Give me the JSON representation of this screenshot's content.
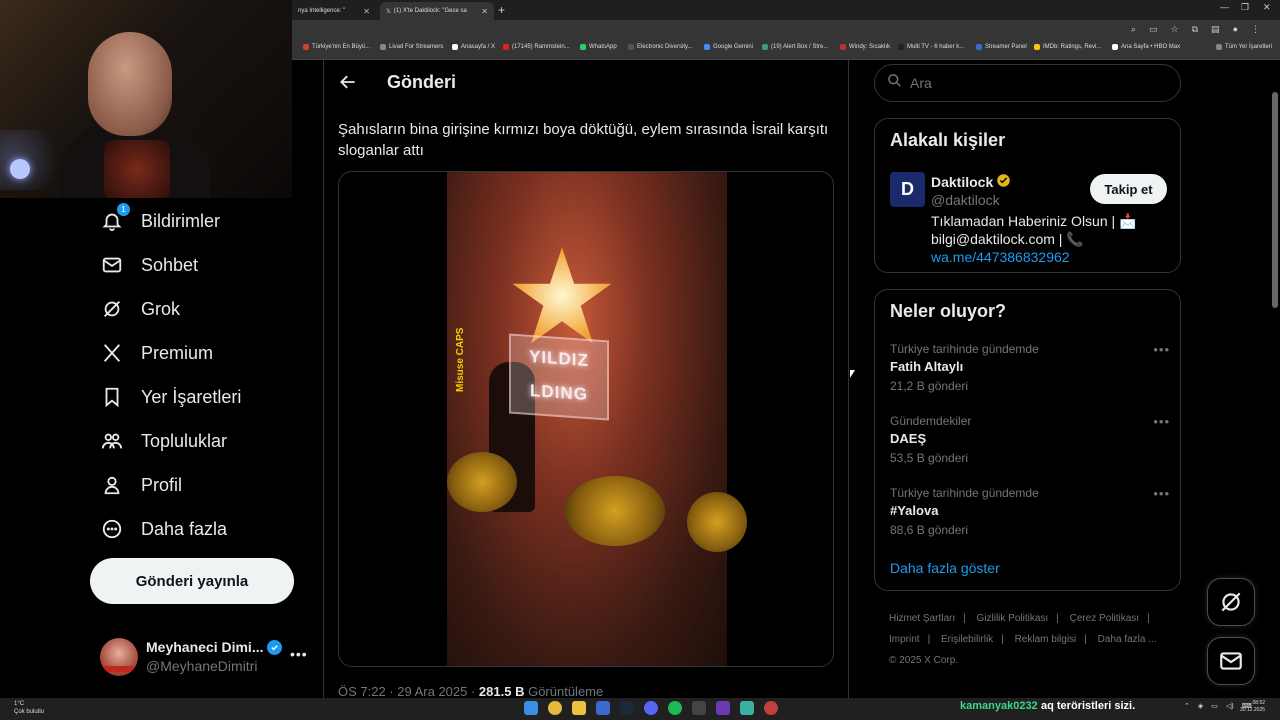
{
  "browser": {
    "tabs": [
      {
        "title": "nya Intelligence: \"",
        "close": "✕"
      },
      {
        "title": "(1) X'te Daktilock: \"Gece sa",
        "close": "✕"
      }
    ],
    "new_tab": "+",
    "bookmarks": [
      {
        "label": "Türkiye'nin En Büyü...",
        "color": "#d0402a"
      },
      {
        "label": "Livad For Streamers",
        "color": "#888888"
      },
      {
        "label": "Anasayfa / X",
        "color": "#ffffff"
      },
      {
        "label": "(17145) Rammstein...",
        "color": "#e02020"
      },
      {
        "label": "WhatsApp",
        "color": "#25d366"
      },
      {
        "label": "Electronic Diversity...",
        "color": "#555555"
      },
      {
        "label": "Google Gemini",
        "color": "#4a8af4"
      },
      {
        "label": "(19) Alert Box / Stre...",
        "color": "#3aa070"
      },
      {
        "label": "Windy: Sıcaklık",
        "color": "#c03030"
      },
      {
        "label": "Multi TV - 6 haber k...",
        "color": "#222222"
      },
      {
        "label": "Streamer Panel",
        "color": "#3a6ad0"
      },
      {
        "label": "IMDb: Ratings, Revi...",
        "color": "#f5c518"
      },
      {
        "label": "Ana Sayfa • HBO Max",
        "color": "#ffffff"
      },
      {
        "label": "Tüm Yer İşaretleri",
        "color": "#888888"
      }
    ]
  },
  "nav": {
    "items": [
      {
        "label": "Bildirimler",
        "icon": "bell-icon",
        "badge": "1"
      },
      {
        "label": "Sohbet",
        "icon": "mail-icon"
      },
      {
        "label": "Grok",
        "icon": "grok-icon"
      },
      {
        "label": "Premium",
        "icon": "x-logo-icon"
      },
      {
        "label": "Yer İşaretleri",
        "icon": "bookmark-icon"
      },
      {
        "label": "Topluluklar",
        "icon": "communities-icon"
      },
      {
        "label": "Profil",
        "icon": "person-icon"
      },
      {
        "label": "Daha fazla",
        "icon": "more-circle-icon"
      }
    ],
    "post_button": "Gönderi yayınla",
    "profile": {
      "name": "Meyhaneci Dimi...",
      "handle": "@MeyhaneDimitri",
      "more": "•••"
    }
  },
  "post": {
    "header_title": "Gönderi",
    "text": "Şahısların bina girişine kırmızı boya döktüğü, eylem sırasında İsrail karşıtı sloganlar attı",
    "sign_line1": "YILDIZ",
    "sign_line2": "LDING",
    "watermark": "Misuse CAPS",
    "meta_time": "ÖS 7:22 · 29 Ara 2025 · ",
    "meta_views_count": "281.5 B",
    "meta_views_label": " Görüntüleme"
  },
  "sidebar": {
    "search_placeholder": "Ara",
    "related": {
      "title": "Alakalı kişiler",
      "name": "Daktilock",
      "handle": "@daktilock",
      "avatar_letter": "D",
      "bio": "Tıklamadan Haberiniz Olsun | 📩 bilgi@daktilock.com | 📞",
      "bio_link": "wa.me/447386832962",
      "follow": "Takip et"
    },
    "trends": {
      "title": "Neler oluyor?",
      "items": [
        {
          "category": "Türkiye tarihinde gündemde",
          "name": "Fatih Altaylı",
          "count": "21,2 B gönderi"
        },
        {
          "category": "Gündemdekiler",
          "name": "DAEŞ",
          "count": "53,5 B gönderi"
        },
        {
          "category": "Türkiye tarihinde gündemde",
          "name": "#Yalova",
          "count": "88,6 B gönderi"
        }
      ],
      "more_dots": "•••",
      "show_more": "Daha fazla göster"
    },
    "footer": {
      "links": [
        "Hizmet Şartları",
        "|",
        "Gizlilik Politikası",
        "|",
        "Çerez Politikası",
        "|",
        "Imprint",
        "|",
        "Erişilebilirlik",
        "|",
        "Reklam bilgisi",
        "|",
        "Daha fazla ..."
      ],
      "copyright": "© 2025 X Corp."
    }
  },
  "taskbar": {
    "temp": "1°C",
    "weather": "Çok bulutlu",
    "chat_user": "kamanyak0232",
    "chat_message": "aq teröristleri sizi.",
    "time": "08:52",
    "date": "30.12.2025"
  },
  "colors": {
    "accent": "#1d9bf0",
    "background": "#000000",
    "text": "#e7e9ea",
    "muted": "#71767b",
    "border": "#2f3336"
  }
}
